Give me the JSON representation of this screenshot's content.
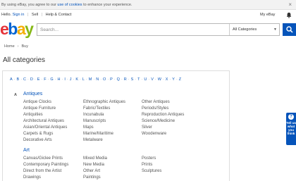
{
  "cookie_bar": {
    "text_before": "By using eBay, you agree to our ",
    "link": "use of cookies",
    "text_after": " to enhance your experience.",
    "close_icon": "close-icon"
  },
  "top_nav": {
    "hello": "Hello.",
    "sign_in": "Sign in",
    "or": "or",
    "register": "register",
    "sell": "Sell",
    "help": "Help & Contact",
    "my_ebay": "My eBay",
    "bell_icon": "bell-icon"
  },
  "header": {
    "logo": {
      "e": "e",
      "b": "b",
      "a": "a",
      "y": "y"
    },
    "search_placeholder": "Search...",
    "category_select": "All Categories",
    "search_icon": "search-icon"
  },
  "breadcrumb": [
    "Home",
    "Buy"
  ],
  "page_title": "All categories",
  "alphabet": [
    "A",
    "B",
    "C",
    "D",
    "E",
    "F",
    "G",
    "H",
    "I",
    "J",
    "K",
    "L",
    "M",
    "N",
    "O",
    "P",
    "Q",
    "R",
    "S",
    "T",
    "U",
    "V",
    "W",
    "X",
    "Y",
    "Z"
  ],
  "sections": [
    {
      "letter": "A",
      "title": "Antiques",
      "columns": [
        [
          "Antique Clocks",
          "Antique Furniture",
          "Antiquities",
          "Architectural Antiques",
          "Asian/Oriental Antiques",
          "Carpets & Rugs",
          "Decorative Arts"
        ],
        [
          "Ethnographic Antiques",
          "Fabric/Textiles",
          "Incunabula",
          "Manuscripts",
          "Maps",
          "Marine/Maritime",
          "Metalware"
        ],
        [
          "Other Antiques",
          "Periods/Styles",
          "Reproduction Antiques",
          "Science/Medicine",
          "Silver",
          "Woodenware"
        ]
      ]
    },
    {
      "title": "Art",
      "columns": [
        [
          "Canvas/Giclee Prints",
          "Contemporary Paintings",
          "Direct from the Artist",
          "Drawings"
        ],
        [
          "Mixed Media",
          "New Media",
          "Other Art",
          "Paintings"
        ],
        [
          "Posters",
          "Prints",
          "Sculptures"
        ]
      ]
    }
  ],
  "feedback": {
    "label": "Tell us what you think",
    "icon": "question-icon"
  },
  "colors": {
    "link": "#0654ba",
    "search_button": "#0654ba"
  }
}
